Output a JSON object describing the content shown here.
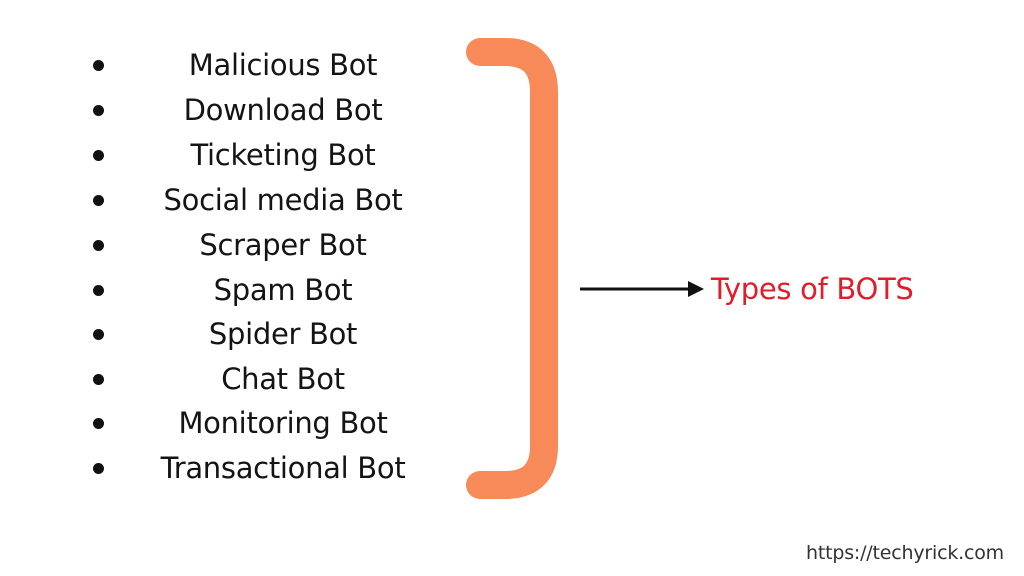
{
  "diagram": {
    "items": [
      {
        "label": "Malicious Bot"
      },
      {
        "label": "Download Bot"
      },
      {
        "label": "Ticketing Bot"
      },
      {
        "label": "Social media Bot"
      },
      {
        "label": "Scraper Bot"
      },
      {
        "label": "Spam Bot"
      },
      {
        "label": "Spider Bot"
      },
      {
        "label": "Chat Bot"
      },
      {
        "label": "Monitoring Bot"
      },
      {
        "label": "Transactional Bot"
      }
    ],
    "bracket_color": "#F88A5A",
    "arrow_icon": "right-arrow",
    "target_label": "Types of BOTS",
    "target_color": "#E11D2B"
  },
  "footer": {
    "url": "https://techyrick.com"
  }
}
